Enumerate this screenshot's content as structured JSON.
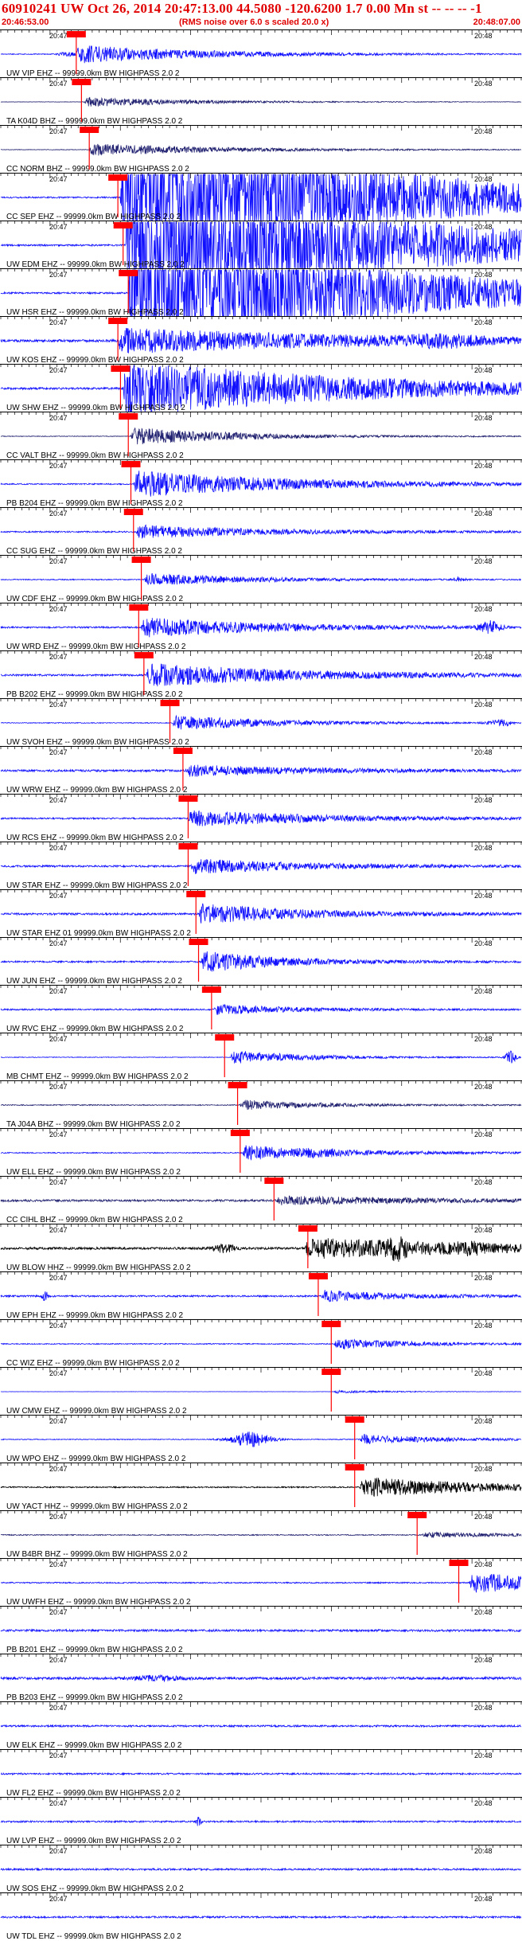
{
  "header": {
    "title": "60910241 UW Oct 26, 2014 20:47:13.00   44.5080 -120.6200  1.7 0.00 Mn st -- -- --  -1",
    "start_time": "20:46:53.00",
    "note": "(RMS noise over 6.0 s scaled 20.0 x)",
    "end_time": "20:48:07.00"
  },
  "minute_labels": [
    "20:47",
    "20:48"
  ],
  "colors": {
    "trace_blue": "#1010ff",
    "trace_dark": "#202070",
    "trace_black": "#000000",
    "pick_red": "#ff0000",
    "axis": "#000000",
    "title_red": "#e00000"
  },
  "traces": [
    {
      "label": "UW VIP EHZ -- 99999.0km BW  HIGHPASS  2.0  2",
      "left_time": "20:47",
      "right_time": "20:48",
      "color": "blue",
      "pick": 0.145,
      "onset": 0.145,
      "env": 0.25,
      "peak": 2.2,
      "noise": 0.09,
      "bursts": [
        {
          "p": 0.13,
          "a": 0.5,
          "w": 0.02
        }
      ]
    },
    {
      "label": "TA K04D BHZ -- 99999.0km BW  HIGHPASS  2.0  2",
      "left_time": "20:47",
      "right_time": "20:48",
      "color": "dark",
      "pick": 0.155,
      "onset": 0.16,
      "env": 0.2,
      "peak": 1.2,
      "noise": 0.05,
      "bursts": []
    },
    {
      "label": "CC NORM BHZ -- 99999.0km BW  HIGHPASS  2.0  2",
      "left_time": "20:47",
      "right_time": "20:48",
      "color": "dark",
      "pick": 0.17,
      "onset": 0.17,
      "env": 0.25,
      "peak": 1.5,
      "noise": 0.06,
      "bursts": []
    },
    {
      "label": "CC SEP EHZ -- 99999.0km BW  HIGHPASS  2.0  2",
      "left_time": "20:47",
      "right_time": "20:48",
      "color": "blue",
      "pick": 0.225,
      "onset": 0.23,
      "env": 0.45,
      "peak": 20,
      "noise": 0.18,
      "bursts": []
    },
    {
      "label": "UW EDM EHZ -- 99999.0km BW  HIGHPASS  2.0  2",
      "left_time": "20:47",
      "right_time": "20:48",
      "color": "blue",
      "pick": 0.235,
      "onset": 0.24,
      "env": 0.45,
      "peak": 20,
      "noise": 0.2,
      "bursts": []
    },
    {
      "label": "UW HSR EHZ -- 99999.0km BW  HIGHPASS  2.0  2",
      "left_time": "20:47",
      "right_time": "20:48",
      "color": "blue",
      "pick": 0.245,
      "onset": 0.245,
      "env": 0.4,
      "peak": 20,
      "noise": 0.2,
      "bursts": []
    },
    {
      "label": "UW KOS EHZ -- 99999.0km BW  HIGHPASS  2.0  2",
      "left_time": "20:47",
      "right_time": "20:48",
      "color": "blue",
      "pick": 0.225,
      "onset": 0.225,
      "env": 0.5,
      "peak": 3.0,
      "noise": 0.3,
      "bursts": [
        {
          "p": 0.85,
          "a": 0.9,
          "w": 0.06
        }
      ]
    },
    {
      "label": "UW SHW EHZ -- 99999.0km BW  HIGHPASS  2.0  2",
      "left_time": "20:47",
      "right_time": "20:48",
      "color": "blue",
      "pick": 0.23,
      "onset": 0.235,
      "env": 0.45,
      "peak": 7,
      "noise": 0.25,
      "bursts": []
    },
    {
      "label": "CC VALT BHZ -- 99999.0km BW  HIGHPASS  2.0  2",
      "left_time": "20:47",
      "right_time": "20:48",
      "color": "dark",
      "pick": 0.245,
      "onset": 0.25,
      "env": 0.2,
      "peak": 2.2,
      "noise": 0.08,
      "bursts": []
    },
    {
      "label": "PB B204 EHZ -- 99999.0km BW  HIGHPASS  2.0  2",
      "left_time": "20:47",
      "right_time": "20:48",
      "color": "blue",
      "pick": 0.25,
      "onset": 0.255,
      "env": 0.3,
      "peak": 3.2,
      "noise": 0.15,
      "bursts": []
    },
    {
      "label": "CC SUG EHZ -- 99999.0km BW  HIGHPASS  2.0  2",
      "left_time": "20:47",
      "right_time": "20:48",
      "color": "blue",
      "pick": 0.255,
      "onset": 0.26,
      "env": 0.25,
      "peak": 1.6,
      "noise": 0.18,
      "bursts": []
    },
    {
      "label": "UW CDF EHZ -- 99999.0km BW  HIGHPASS  2.0  2",
      "left_time": "20:47",
      "right_time": "20:48",
      "color": "blue",
      "pick": 0.27,
      "onset": 0.275,
      "env": 0.2,
      "peak": 1.5,
      "noise": 0.12,
      "bursts": [
        {
          "p": 0.88,
          "a": 0.6,
          "w": 0.01
        }
      ]
    },
    {
      "label": "UW WRD EHZ -- 99999.0km BW  HIGHPASS  2.0  2",
      "left_time": "20:47",
      "right_time": "20:48",
      "color": "blue",
      "pick": 0.265,
      "onset": 0.27,
      "env": 0.25,
      "peak": 2.4,
      "noise": 0.2,
      "bursts": [
        {
          "p": 0.94,
          "a": 1.4,
          "w": 0.02
        }
      ]
    },
    {
      "label": "PB B202 EHZ -- 99999.0km BW  HIGHPASS  2.0  2",
      "left_time": "20:47",
      "right_time": "20:48",
      "color": "blue",
      "pick": 0.275,
      "onset": 0.28,
      "env": 0.3,
      "peak": 2.8,
      "noise": 0.22,
      "bursts": []
    },
    {
      "label": "UW SVOH EHZ -- 99999.0km BW  HIGHPASS  2.0  2",
      "left_time": "20:47",
      "right_time": "20:48",
      "color": "blue",
      "pick": 0.325,
      "onset": 0.33,
      "env": 0.2,
      "peak": 1.8,
      "noise": 0.1,
      "bursts": [
        {
          "p": 0.96,
          "a": 0.8,
          "w": 0.02
        }
      ]
    },
    {
      "label": "UW WRW EHZ -- 99999.0km BW  HIGHPASS  2.0  2",
      "left_time": "20:47",
      "right_time": "20:48",
      "color": "blue",
      "pick": 0.35,
      "onset": 0.355,
      "env": 0.25,
      "peak": 1.3,
      "noise": 0.25,
      "bursts": []
    },
    {
      "label": "UW RCS EHZ -- 99999.0km BW  HIGHPASS  2.0  2",
      "left_time": "20:47",
      "right_time": "20:48",
      "color": "blue",
      "pick": 0.36,
      "onset": 0.36,
      "env": 0.25,
      "peak": 2.0,
      "noise": 0.18,
      "bursts": []
    },
    {
      "label": "UW STAR EHZ -- 99999.0km BW  HIGHPASS  2.0  2",
      "left_time": "20:47",
      "right_time": "20:48",
      "color": "blue",
      "pick": 0.36,
      "onset": 0.365,
      "env": 0.22,
      "peak": 1.8,
      "noise": 0.22,
      "bursts": []
    },
    {
      "label": "UW STAR EHZ 01 99999.0km BW  HIGHPASS  2.0  2",
      "left_time": "20:47",
      "right_time": "20:48",
      "color": "blue",
      "pick": 0.375,
      "onset": 0.38,
      "env": 0.2,
      "peak": 2.4,
      "noise": 0.25,
      "bursts": []
    },
    {
      "label": "UW JUN EHZ -- 99999.0km BW  HIGHPASS  2.0  2",
      "left_time": "20:47",
      "right_time": "20:48",
      "color": "blue",
      "pick": 0.38,
      "onset": 0.385,
      "env": 0.15,
      "peak": 2.6,
      "noise": 0.2,
      "bursts": []
    },
    {
      "label": "UW RVC EHZ -- 99999.0km BW  HIGHPASS  2.0  2",
      "left_time": "20:47",
      "right_time": "20:48",
      "color": "blue",
      "pick": 0.405,
      "onset": 0.41,
      "env": 0.15,
      "peak": 1.2,
      "noise": 0.18,
      "bursts": []
    },
    {
      "label": "MB CHMT EHZ -- 99999.0km BW  HIGHPASS  2.0  2",
      "left_time": "20:47",
      "right_time": "20:48",
      "color": "blue",
      "pick": 0.43,
      "onset": 0.44,
      "env": 0.15,
      "peak": 1.6,
      "noise": 0.08,
      "bursts": [
        {
          "p": 0.98,
          "a": 1.6,
          "w": 0.01
        }
      ]
    },
    {
      "label": "TA J04A BHZ -- 99999.0km BW  HIGHPASS  2.0  2",
      "left_time": "20:47",
      "right_time": "20:48",
      "color": "dark",
      "pick": 0.455,
      "onset": 0.46,
      "env": 0.15,
      "peak": 1.2,
      "noise": 0.12,
      "bursts": []
    },
    {
      "label": "UW ELL EHZ -- 99999.0km BW  HIGHPASS  2.0  2",
      "left_time": "20:47",
      "right_time": "20:48",
      "color": "blue",
      "pick": 0.46,
      "onset": 0.465,
      "env": 0.2,
      "peak": 1.8,
      "noise": 0.12,
      "bursts": [
        {
          "p": 0.62,
          "a": 0.35,
          "w": 0.03
        }
      ]
    },
    {
      "label": "CC CIHL BHZ -- 99999.0km BW  HIGHPASS  2.0  2",
      "left_time": "20:47",
      "right_time": "20:48",
      "color": "dark",
      "pick": 0.525,
      "onset": 0.53,
      "env": 0.3,
      "peak": 1.0,
      "noise": 0.25,
      "bursts": []
    },
    {
      "label": "UW BLOW HHZ -- 99999.0km BW  HIGHPASS  2.0  2",
      "left_time": "20:47",
      "right_time": "20:48",
      "color": "black",
      "pick": 0.59,
      "onset": 0.585,
      "env": 0.35,
      "peak": 2.5,
      "noise": 0.28,
      "bursts": [
        {
          "p": 0.43,
          "a": 1.0,
          "w": 0.02
        },
        {
          "p": 0.76,
          "a": 1.6,
          "w": 0.02
        },
        {
          "p": 0.9,
          "a": 0.7,
          "w": 0.03
        }
      ]
    },
    {
      "label": "UW EPH EHZ -- 99999.0km BW  HIGHPASS  2.0  2",
      "left_time": "20:47",
      "right_time": "20:48",
      "color": "blue",
      "pick": 0.61,
      "onset": 0.615,
      "env": 0.15,
      "peak": 1.4,
      "noise": 0.2,
      "bursts": [
        {
          "p": 0.085,
          "a": 1.5,
          "w": 0.005
        }
      ]
    },
    {
      "label": "CC WIZ EHZ -- 99999.0km BW  HIGHPASS  2.0  2",
      "left_time": "20:47",
      "right_time": "20:48",
      "color": "blue",
      "pick": 0.635,
      "onset": 0.64,
      "env": 0.15,
      "peak": 1.3,
      "noise": 0.12,
      "bursts": []
    },
    {
      "label": "UW CMW EHZ -- 99999.0km BW  HIGHPASS  2.0  2",
      "left_time": "20:47",
      "right_time": "20:48",
      "color": "blue",
      "pick": 0.635,
      "onset": 0.64,
      "env": 0.1,
      "peak": 0.4,
      "noise": 0.03,
      "bursts": []
    },
    {
      "label": "UW WPO EHZ -- 99999.0km BW  HIGHPASS  2.0  2",
      "left_time": "20:47",
      "right_time": "20:48",
      "color": "blue",
      "pick": 0.68,
      "onset": 0.69,
      "env": 0.15,
      "peak": 1.2,
      "noise": 0.1,
      "bursts": [
        {
          "p": 0.48,
          "a": 1.8,
          "w": 0.04
        }
      ]
    },
    {
      "label": "UW YACT HHZ -- 99999.0km BW  HIGHPASS  2.0  2",
      "left_time": "20:47",
      "right_time": "20:48",
      "color": "black",
      "pick": 0.68,
      "onset": 0.69,
      "env": 0.25,
      "peak": 2.4,
      "noise": 0.15,
      "bursts": []
    },
    {
      "label": "UW B4BR BHZ -- 99999.0km BW  HIGHPASS  2.0  2",
      "left_time": "20:47",
      "right_time": "20:48",
      "color": "dark",
      "pick": 0.8,
      "onset": 0.81,
      "env": 0.2,
      "peak": 0.6,
      "noise": 0.12,
      "bursts": []
    },
    {
      "label": "UW UWFH EHZ -- 99999.0km BW  HIGHPASS  2.0  2",
      "left_time": "20:47",
      "right_time": "20:48",
      "color": "blue",
      "pick": 0.88,
      "onset": 0.9,
      "env": 0.2,
      "peak": 2.5,
      "noise": 0.15,
      "bursts": []
    },
    {
      "label": "PB B201 EHZ -- 99999.0km BW  HIGHPASS  2.0  2",
      "left_time": "20:47",
      "right_time": "20:48",
      "color": "blue",
      "pick": null,
      "onset": null,
      "env": 0.2,
      "peak": 0,
      "noise": 0.25,
      "bursts": []
    },
    {
      "label": "PB B203 EHZ -- 99999.0km BW  HIGHPASS  2.0  2",
      "left_time": "20:47",
      "right_time": "20:48",
      "color": "blue",
      "pick": null,
      "onset": null,
      "env": 0.2,
      "peak": 0,
      "noise": 0.3,
      "bursts": [
        {
          "p": 0.3,
          "a": 0.5,
          "w": 0.05
        }
      ]
    },
    {
      "label": "UW ELK EHZ -- 99999.0km BW  HIGHPASS  2.0  2",
      "left_time": "20:47",
      "right_time": "20:48",
      "color": "blue",
      "pick": null,
      "onset": null,
      "env": 0.2,
      "peak": 0,
      "noise": 0.22,
      "bursts": []
    },
    {
      "label": "UW FL2 EHZ -- 99999.0km BW  HIGHPASS  2.0  2",
      "left_time": "20:47",
      "right_time": "20:48",
      "color": "blue",
      "pick": null,
      "onset": null,
      "env": 0.2,
      "peak": 0,
      "noise": 0.2,
      "bursts": []
    },
    {
      "label": "UW LVP EHZ -- 99999.0km BW  HIGHPASS  2.0  2",
      "left_time": "20:47",
      "right_time": "20:48",
      "color": "blue",
      "pick": null,
      "onset": null,
      "env": 0.2,
      "peak": 0,
      "noise": 0.2,
      "bursts": [
        {
          "p": 0.38,
          "a": 1.0,
          "w": 0.005
        }
      ]
    },
    {
      "label": "UW SOS EHZ -- 99999.0km BW  HIGHPASS  2.0  2",
      "left_time": "20:47",
      "right_time": "20:48",
      "color": "blue",
      "pick": null,
      "onset": null,
      "env": 0.2,
      "peak": 0,
      "noise": 0.22,
      "bursts": []
    },
    {
      "label": "UW TDL EHZ -- 99999.0km BW  HIGHPASS  2.0  2",
      "left_time": "20:47",
      "right_time": "20:48",
      "color": "blue",
      "pick": null,
      "onset": null,
      "env": 0.2,
      "peak": 0,
      "noise": 0.22,
      "bursts": []
    }
  ]
}
